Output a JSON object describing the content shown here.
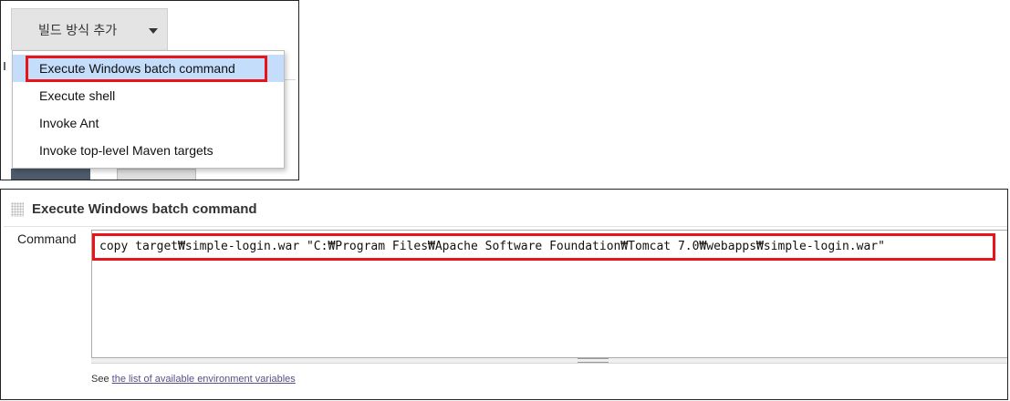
{
  "build_step_menu": {
    "add_button_label": "빌드 방식 추가",
    "items": [
      {
        "label": "Execute Windows batch command",
        "highlighted": true
      },
      {
        "label": "Execute shell",
        "highlighted": false
      },
      {
        "label": "Invoke Ant",
        "highlighted": false
      },
      {
        "label": "Invoke top-level Maven targets",
        "highlighted": false
      }
    ]
  },
  "build_step_section": {
    "title": "Execute Windows batch command",
    "command_label": "Command",
    "command_value": "copy target₩simple-login.war \"C:₩Program Files₩Apache Software Foundation₩Tomcat 7.0₩webapps₩simple-login.war\"",
    "help_prefix": "See ",
    "help_link": "the list of available environment variables"
  },
  "colors": {
    "annotation_red": "#e8141a",
    "menu_highlight": "#c4ddfa",
    "link_color": "#5b4d88"
  },
  "icons": {
    "dropdown_caret": "caret-down-icon",
    "section_grip": "drag-handle-icon",
    "textarea_grip": "resize-handle-icon"
  }
}
